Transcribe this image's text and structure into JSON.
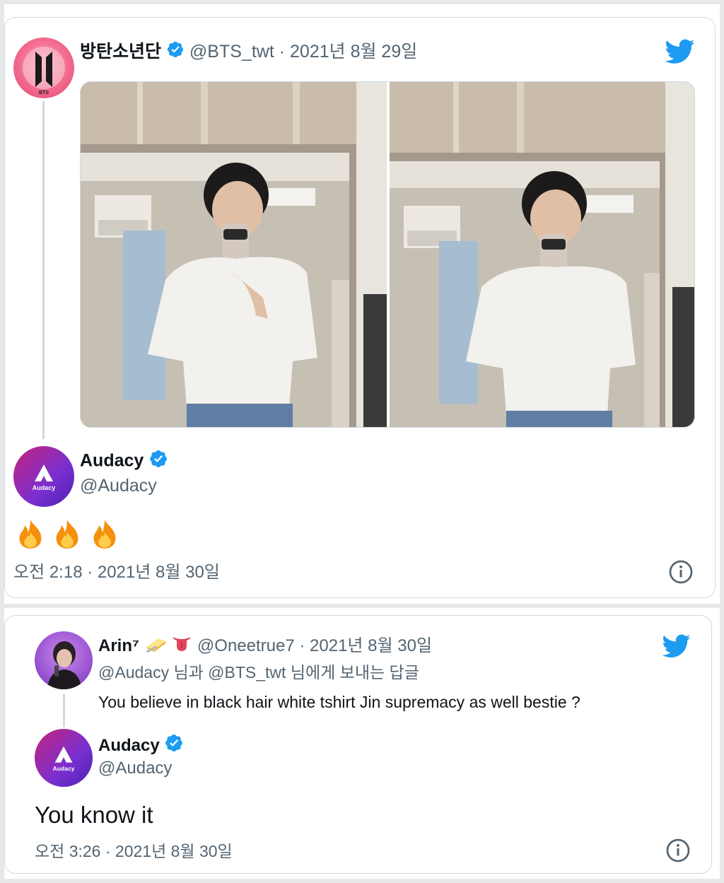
{
  "tweet1": {
    "author_name": "방탄소년단",
    "author_handle": "@BTS_twt",
    "date": "· 2021년 8월 29일",
    "avatar_text": "BTS",
    "photos": [
      "mirror-selfie-1",
      "mirror-selfie-2"
    ]
  },
  "reply1": {
    "author_name": "Audacy",
    "author_handle": "@Audacy",
    "avatar_text": "Audacy",
    "body_icons": [
      "fire-emoji",
      "fire-emoji",
      "fire-emoji"
    ],
    "timestamp": "오전 2:18 · 2021년 8월 30일"
  },
  "tweet2": {
    "author_name": "Arin⁷",
    "author_handle": "@Oneetrue7",
    "date": "· 2021년 8월 30일",
    "emoji_icons": [
      "butter-emoji",
      "tongue-emoji"
    ],
    "reply_to": "@Audacy 님과 @BTS_twt 님에게 보내는 답글",
    "body": "You believe in black hair white tshirt Jin supremacy as well bestie ?"
  },
  "reply2": {
    "author_name": "Audacy",
    "author_handle": "@Audacy",
    "avatar_text": "Audacy",
    "body": "You know it",
    "timestamp": "오전 3:26 · 2021년 8월 30일"
  },
  "colors": {
    "twitter_blue": "#1d9bf0",
    "text_primary": "#0f1419",
    "text_muted": "#536471",
    "border": "#cfd9de",
    "bts_pink": "#e8577a",
    "audacy_purple": "#6a2fd0"
  }
}
